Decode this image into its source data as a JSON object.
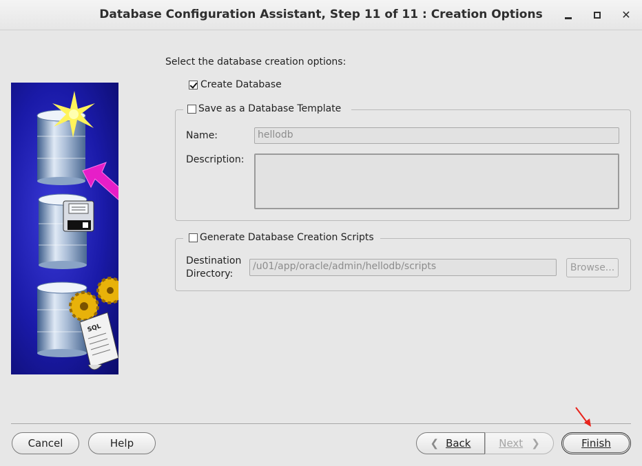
{
  "window": {
    "title": "Database Configuration Assistant, Step 11 of 11 : Creation Options",
    "minimize_glyph": "_",
    "maximize_glyph": "□",
    "close_glyph": "✕"
  },
  "main": {
    "instruction": "Select the database creation options:",
    "create_database": {
      "label": "Create Database",
      "checked": true
    },
    "template": {
      "label": "Save as a Database Template",
      "checked": false,
      "name_label": "Name:",
      "name_value": "hellodb",
      "description_label": "Description:",
      "description_value": ""
    },
    "scripts": {
      "label": "Generate Database Creation Scripts",
      "checked": false,
      "destination_label_line1": "Destination",
      "destination_label_line2": "Directory:",
      "destination_value": "/u01/app/oracle/admin/hellodb/scripts",
      "browse_label": "Browse..."
    }
  },
  "footer": {
    "cancel_label": "Cancel",
    "help_label": "Help",
    "back_label": "Back",
    "next_label": "Next",
    "finish_label": "Finish"
  },
  "colors": {
    "annotation_arrow": "#e8241c",
    "art_background": "#1a1aa8",
    "pointer_arrow": "#e61ec8"
  }
}
